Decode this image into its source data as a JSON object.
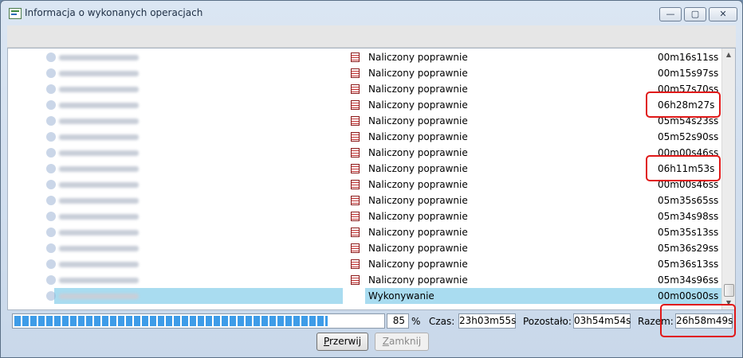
{
  "window": {
    "title": "Informacja o wykonanych operacjach",
    "controls": {
      "minimize": "—",
      "maximize": "▢",
      "close": "✕"
    }
  },
  "rows": [
    {
      "status": "Naliczony poprawnie",
      "time": "00m16s11ss"
    },
    {
      "status": "Naliczony poprawnie",
      "time": "00m15s97ss"
    },
    {
      "status": "Naliczony poprawnie",
      "time": "00m57s70ss"
    },
    {
      "status": "Naliczony poprawnie",
      "time": "06h28m27s"
    },
    {
      "status": "Naliczony poprawnie",
      "time": "05m54s23ss"
    },
    {
      "status": "Naliczony poprawnie",
      "time": "05m52s90ss"
    },
    {
      "status": "Naliczony poprawnie",
      "time": "00m00s46ss"
    },
    {
      "status": "Naliczony poprawnie",
      "time": "06h11m53s"
    },
    {
      "status": "Naliczony poprawnie",
      "time": "00m00s46ss"
    },
    {
      "status": "Naliczony poprawnie",
      "time": "05m35s65ss"
    },
    {
      "status": "Naliczony poprawnie",
      "time": "05m34s98ss"
    },
    {
      "status": "Naliczony poprawnie",
      "time": "05m35s13ss"
    },
    {
      "status": "Naliczony poprawnie",
      "time": "05m36s29ss"
    },
    {
      "status": "Naliczony poprawnie",
      "time": "05m36s13ss"
    },
    {
      "status": "Naliczony poprawnie",
      "time": "05m34s96ss"
    },
    {
      "status": "Wykonywanie",
      "time": "00m00s00ss"
    }
  ],
  "highlighted_rows": [
    3,
    7
  ],
  "active_row": 15,
  "progress": {
    "percent_value": "85",
    "percent_fraction": 0.85,
    "percent_symbol": "%"
  },
  "stats": {
    "czas_label": "Czas:",
    "czas_value": "23h03m55s",
    "pozostalo_label": "Pozostało:",
    "pozostalo_value": "03h54m54s",
    "razem_label": "Razem:",
    "razem_value": "26h58m49s"
  },
  "buttons": {
    "przerwij": {
      "mnemonic": "P",
      "rest": "rzerwij"
    },
    "zamknij": {
      "mnemonic": "Z",
      "rest": "amknij"
    }
  },
  "colors": {
    "highlight_border": "#e01818",
    "selection": "#a9dcf0",
    "progress_fill": "#3e9ce8"
  }
}
